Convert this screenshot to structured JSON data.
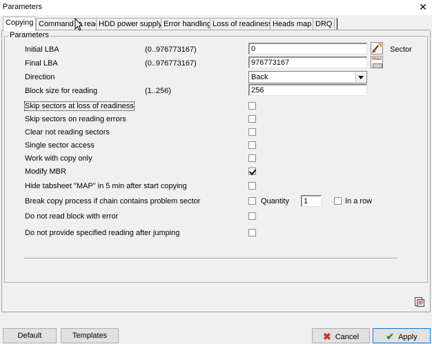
{
  "window": {
    "title": "Parameters",
    "close_glyph": "✕"
  },
  "tabs": [
    {
      "label": "Copying"
    },
    {
      "label": "Command to read"
    },
    {
      "label": "HDD power supply"
    },
    {
      "label": "Error handling"
    },
    {
      "label": "Loss of readiness"
    },
    {
      "label": "Heads map"
    },
    {
      "label": "DRQ"
    }
  ],
  "group": {
    "label": "Parameters"
  },
  "fields": {
    "initial_lba": {
      "label": "Initial LBA",
      "range": "(0..976773167)",
      "value": "0",
      "unit": "Sector"
    },
    "final_lba": {
      "label": "Final  LBA",
      "range": "(0..976773167)",
      "value": "976773167",
      "max_icon_text": "max"
    },
    "direction": {
      "label": "Direction",
      "value": "Back"
    },
    "block_size": {
      "label": "Block size for reading",
      "range": "(1..256)",
      "value": "256"
    }
  },
  "options": [
    {
      "label": "Skip sectors at loss of readiness",
      "checked": false
    },
    {
      "label": "Skip sectors on reading errors",
      "checked": false
    },
    {
      "label": "Clear not reading sectors",
      "checked": false
    },
    {
      "label": "Single sector access",
      "checked": false
    },
    {
      "label": "Work with copy only",
      "checked": false
    },
    {
      "label": "Modify MBR",
      "checked": true
    },
    {
      "label": "Hide tabsheet \"MAP\" in 5 min after start copying",
      "checked": false
    },
    {
      "label": "Break copy process if chain contains problem sector",
      "checked": false
    },
    {
      "label": "Do not read block with error",
      "checked": false
    },
    {
      "label": "Do not provide specified reading after jumping",
      "checked": false
    }
  ],
  "break_chain": {
    "quantity_label": "Quantity",
    "quantity_value": "1",
    "in_a_row_label": "In a row",
    "in_a_row_checked": false
  },
  "buttons": {
    "default": "Default",
    "templates": "Templates",
    "cancel": "Cancel",
    "apply": "Apply"
  },
  "colors": {
    "cancel_x": "#c0392b",
    "apply_check": "#2e8b2e",
    "accent_border": "#0078d7"
  }
}
